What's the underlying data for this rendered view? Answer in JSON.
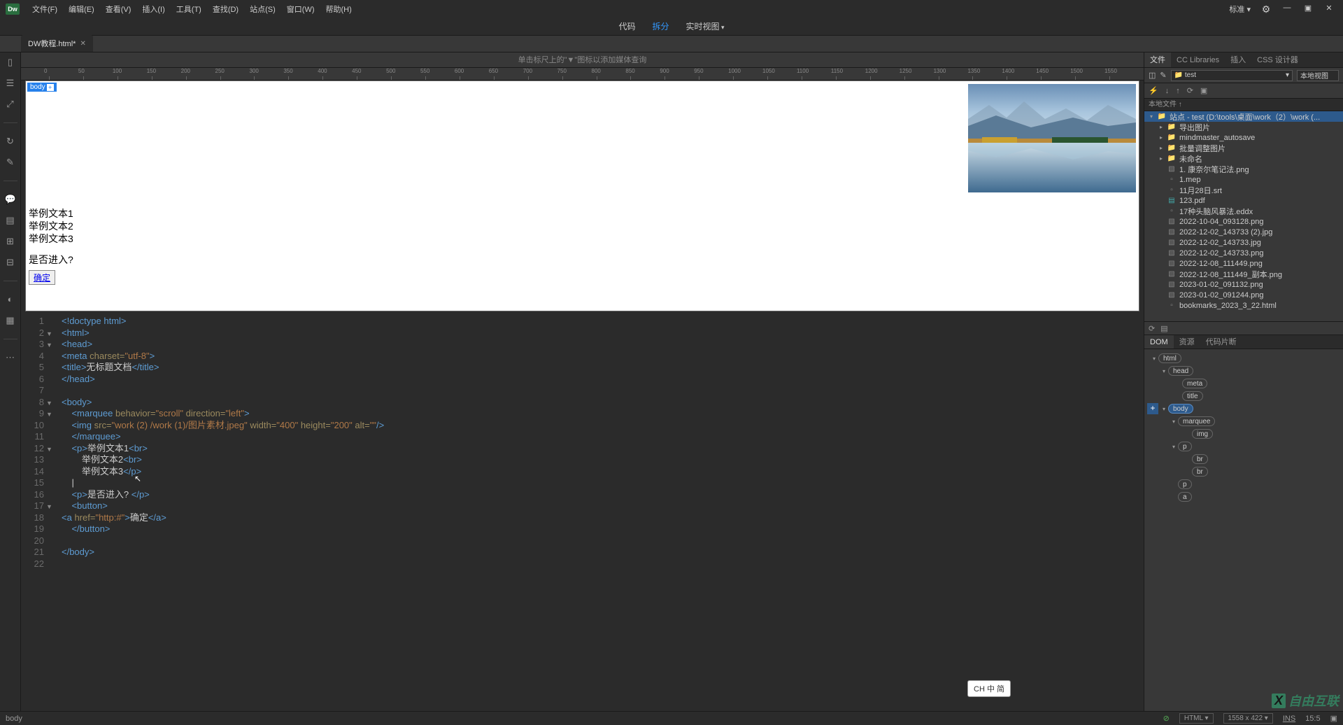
{
  "app": {
    "logo": "Dw"
  },
  "menu": [
    "文件(F)",
    "编辑(E)",
    "查看(V)",
    "插入(I)",
    "工具(T)",
    "查找(D)",
    "站点(S)",
    "窗口(W)",
    "帮助(H)"
  ],
  "titlebar_right": {
    "workspace": "标准 ▾"
  },
  "viewbar": {
    "code": "代码",
    "split": "拆分",
    "live": "实时视图"
  },
  "filetab": {
    "name": "DW教程.html*"
  },
  "ruler_hint": "单击标尺上的\"▼\"图标以添加媒体查询",
  "ruler_marks": [
    "0",
    "50",
    "100",
    "150",
    "200",
    "250",
    "300",
    "350",
    "400",
    "450",
    "500",
    "550",
    "600",
    "650",
    "700",
    "750",
    "800",
    "850",
    "900",
    "950",
    "1000",
    "1050",
    "1100",
    "1150",
    "1200",
    "1250",
    "1300",
    "1350",
    "1400",
    "1450",
    "1500",
    "1550"
  ],
  "preview": {
    "body_tag": "body",
    "text1": "举例文本1",
    "text2": "举例文本2",
    "text3": "举例文本3",
    "question": "是否进入?",
    "button": "确定"
  },
  "code_lines": [
    {
      "n": "1",
      "fold": "",
      "html": "<span class='tag'>&lt;!doctype html&gt;</span>"
    },
    {
      "n": "2",
      "fold": "▼",
      "html": "<span class='tag'>&lt;html&gt;</span>"
    },
    {
      "n": "3",
      "fold": "▼",
      "html": "<span class='tag'>&lt;head&gt;</span>"
    },
    {
      "n": "4",
      "fold": "",
      "html": "<span class='tag'>&lt;meta</span> <span class='attr'>charset=</span><span class='str'>\"utf-8\"</span><span class='tag'>&gt;</span>"
    },
    {
      "n": "5",
      "fold": "",
      "html": "<span class='tag'>&lt;title&gt;</span><span class='txt'>无标题文档</span><span class='tag'>&lt;/title&gt;</span>"
    },
    {
      "n": "6",
      "fold": "",
      "html": "<span class='tag'>&lt;/head&gt;</span>"
    },
    {
      "n": "7",
      "fold": "",
      "html": ""
    },
    {
      "n": "8",
      "fold": "▼",
      "html": "<span class='tag'>&lt;body&gt;</span>"
    },
    {
      "n": "9",
      "fold": "▼",
      "html": "    <span class='tag'>&lt;marquee</span> <span class='attr'>behavior=</span><span class='str'>\"scroll\"</span> <span class='attr'>direction=</span><span class='str'>\"left\"</span><span class='tag'>&gt;</span>"
    },
    {
      "n": "10",
      "fold": "",
      "html": "    <span class='tag'>&lt;img</span> <span class='attr'>src=</span><span class='str'>\"work (2) /work (1)/图片素材.jpeg\"</span> <span class='attr'>width=</span><span class='str'>\"400\"</span> <span class='attr'>height=</span><span class='str'>\"200\"</span> <span class='attr'>alt=</span><span class='str'>\"\"</span><span class='tag'>/&gt;</span>"
    },
    {
      "n": "11",
      "fold": "",
      "html": "    <span class='tag'>&lt;/marquee&gt;</span>"
    },
    {
      "n": "12",
      "fold": "▼",
      "html": "    <span class='tag'>&lt;p&gt;</span><span class='txt'>举例文本1</span><span class='tag'>&lt;br&gt;</span>"
    },
    {
      "n": "13",
      "fold": "",
      "html": "        <span class='txt'>举例文本2</span><span class='tag'>&lt;br&gt;</span>"
    },
    {
      "n": "14",
      "fold": "",
      "html": "        <span class='txt'>举例文本3</span><span class='tag'>&lt;/p&gt;</span>"
    },
    {
      "n": "15",
      "fold": "",
      "html": "    |"
    },
    {
      "n": "16",
      "fold": "",
      "html": "    <span class='tag'>&lt;p&gt;</span><span class='txt'>是否进入?</span> <span class='tag'>&lt;/p&gt;</span>"
    },
    {
      "n": "17",
      "fold": "▼",
      "html": "    <span class='tag'>&lt;button&gt;</span>"
    },
    {
      "n": "18",
      "fold": "",
      "html": "<span class='tag'>&lt;a</span> <span class='attr'>href=</span><span class='str'>\"http:#\"</span><span class='tag'>&gt;</span><span class='txt'>确定</span><span class='tag'>&lt;/a&gt;</span>"
    },
    {
      "n": "19",
      "fold": "",
      "html": "    <span class='tag'>&lt;/button&gt;</span>"
    },
    {
      "n": "20",
      "fold": "",
      "html": ""
    },
    {
      "n": "21",
      "fold": "",
      "html": "<span class='tag'>&lt;/body&gt;</span>"
    },
    {
      "n": "22",
      "fold": "",
      "html": ""
    }
  ],
  "right_panel": {
    "tabs": [
      "文件",
      "CC Libraries",
      "插入",
      "CSS 设计器"
    ],
    "site_dropdown": "test",
    "view_dropdown": "本地视图",
    "local_files_header": "本地文件 ↑",
    "root": "站点 - test (D:\\tools\\桌面\\work（2）\\work (...",
    "folders": [
      "导出图片",
      "mindmaster_autosave",
      "批量调整图片",
      "未命名"
    ],
    "files": [
      {
        "name": "1. 康奈尔笔记法.png",
        "type": "png"
      },
      {
        "name": "1.mep",
        "type": "gen"
      },
      {
        "name": "11月28日.srt",
        "type": "gen"
      },
      {
        "name": "123.pdf",
        "type": "pdf"
      },
      {
        "name": "17种头脑风暴法.eddx",
        "type": "gen"
      },
      {
        "name": "2022-10-04_093128.png",
        "type": "png"
      },
      {
        "name": "2022-12-02_143733 (2).jpg",
        "type": "png"
      },
      {
        "name": "2022-12-02_143733.jpg",
        "type": "png"
      },
      {
        "name": "2022-12-02_143733.png",
        "type": "png"
      },
      {
        "name": "2022-12-08_111449.png",
        "type": "png"
      },
      {
        "name": "2022-12-08_111449_副本.png",
        "type": "png"
      },
      {
        "name": "2023-01-02_091132.png",
        "type": "png"
      },
      {
        "name": "2023-01-02_091244.png",
        "type": "png"
      },
      {
        "name": "bookmarks_2023_3_22.html",
        "type": "gen"
      }
    ]
  },
  "dom_panel": {
    "tabs": [
      "DOM",
      "资源",
      "代码片断"
    ],
    "nodes": [
      "html",
      "head",
      "meta",
      "title",
      "body",
      "marquee",
      "img",
      "p",
      "br",
      "br",
      "p",
      "a"
    ]
  },
  "statusbar": {
    "path": "body",
    "lang": "HTML",
    "size": "1558 x 422",
    "ins": "INS",
    "pos": "15:5"
  },
  "ime": "CH 中 简",
  "watermark": "自由互联"
}
